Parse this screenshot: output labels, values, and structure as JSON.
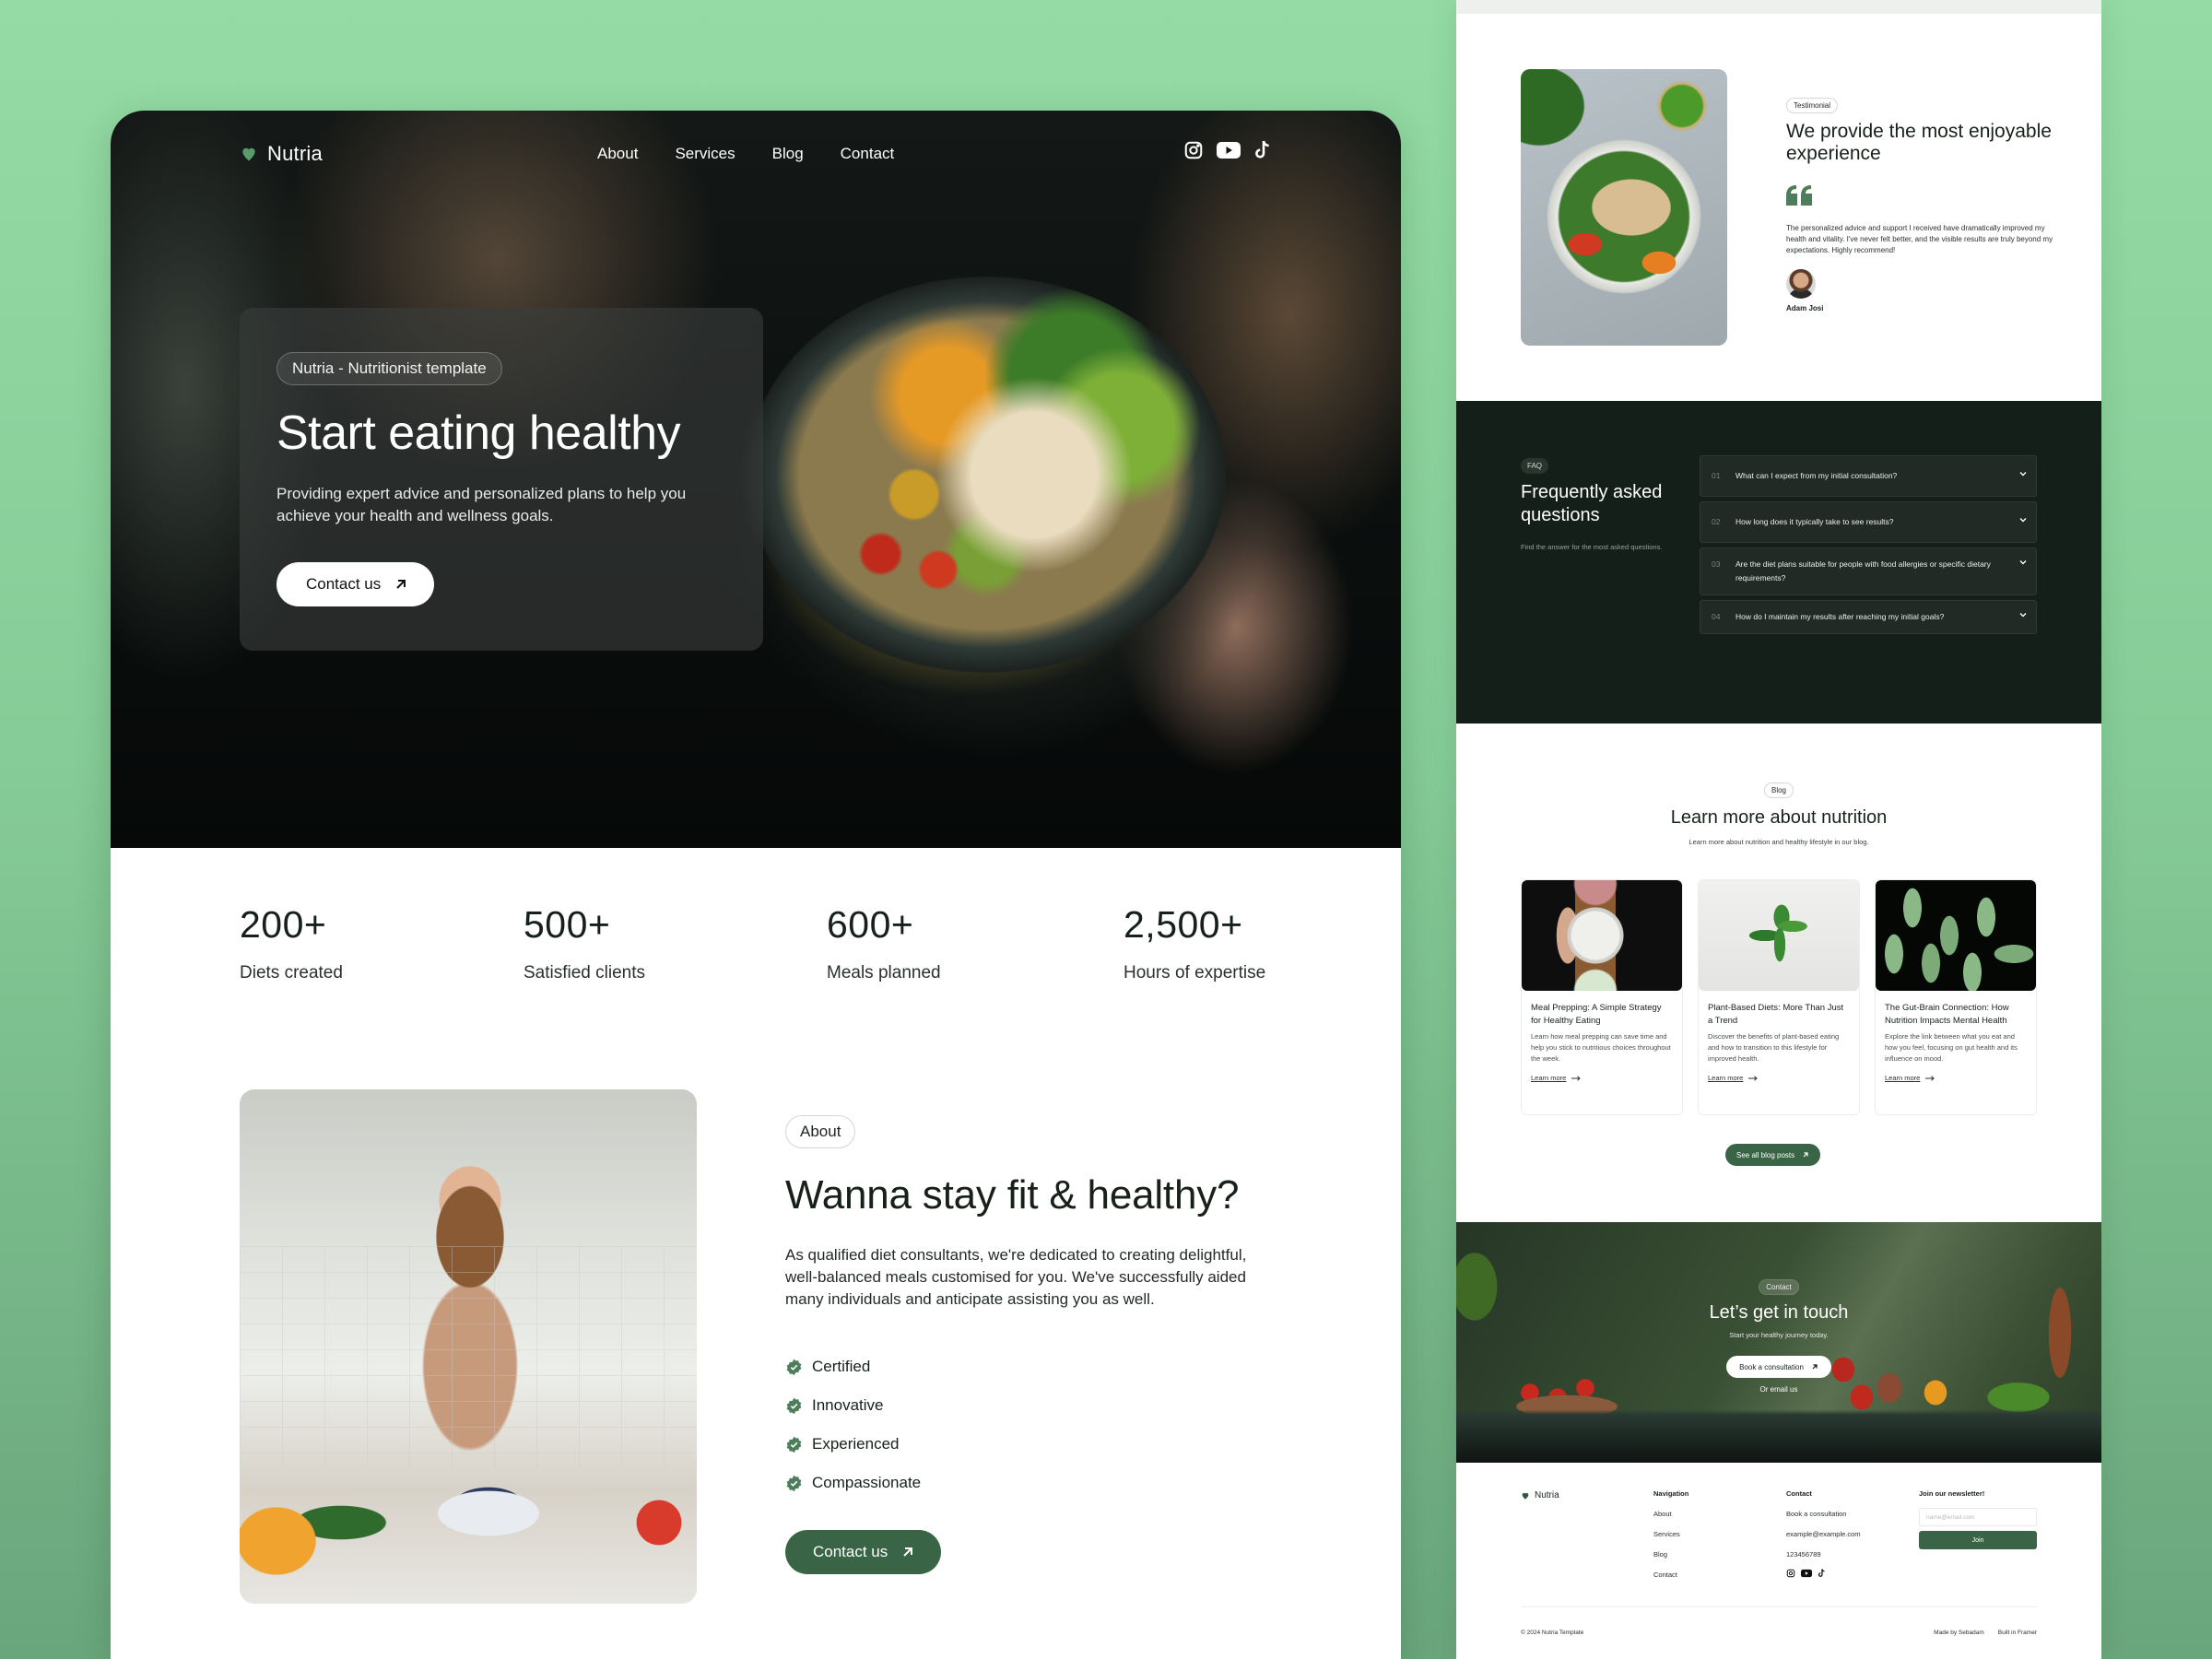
{
  "colors": {
    "brand_green": "#3a6446",
    "logo_green": "#5a9b6b",
    "faq_bg": "#131f18",
    "page_bg": "#95dba5"
  },
  "left": {
    "nav": {
      "logo": "Nutria",
      "links": [
        "About",
        "Services",
        "Blog",
        "Contact"
      ],
      "social": [
        "instagram-icon",
        "youtube-icon",
        "tiktok-icon"
      ]
    },
    "hero": {
      "badge": "Nutria - Nutritionist template",
      "title": "Start eating healthy",
      "subtitle": "Providing expert advice and personalized plans to help you achieve your health and wellness goals.",
      "cta": "Contact us"
    },
    "stats": [
      {
        "value": "200+",
        "label": "Diets created"
      },
      {
        "value": "500+",
        "label": "Satisfied clients"
      },
      {
        "value": "600+",
        "label": "Meals planned"
      },
      {
        "value": "2,500+",
        "label": "Hours of expertise"
      }
    ],
    "about": {
      "badge": "About",
      "title": "Wanna stay fit & healthy?",
      "text": "As qualified diet consultants, we're dedicated to creating delightful, well-balanced meals customised for you. We've successfully aided many individuals and anticipate assisting you as well.",
      "checks": [
        "Certified",
        "Innovative",
        "Experienced",
        "Compassionate"
      ],
      "cta": "Contact us"
    }
  },
  "right": {
    "testimonial": {
      "badge": "Testimonial",
      "title": "We provide the most enjoyable experience",
      "quote": "The personalized advice and support I received have dramatically improved my health and vitality. I've never felt better, and the visible results are truly beyond my expectations. Highly recommend!",
      "author": "Adam Josi"
    },
    "faq": {
      "badge": "FAQ",
      "title": "Frequently asked questions",
      "subtitle": "Find the answer for the most asked questions.",
      "items": [
        {
          "num": "01",
          "q": "What can I expect from my initial consultation?"
        },
        {
          "num": "02",
          "q": "How long does it typically take to see results?"
        },
        {
          "num": "03",
          "q": "Are the diet plans suitable for people with food allergies or specific dietary requirements?"
        },
        {
          "num": "04",
          "q": "How do I maintain my results after reaching my initial goals?"
        }
      ]
    },
    "blog": {
      "badge": "Blog",
      "title": "Learn more about nutrition",
      "subtitle": "Learn more about nutrition and healthy lifestyle in our blog.",
      "posts": [
        {
          "title": "Meal Prepping: A Simple Strategy for Healthy Eating",
          "text": "Learn how meal prepping can save time and help you stick to nutritious choices throughout the week.",
          "link": "Learn more"
        },
        {
          "title": "Plant-Based Diets: More Than Just a Trend",
          "text": "Discover the benefits of plant-based eating and how to transition to this lifestyle for improved health.",
          "link": "Learn more"
        },
        {
          "title": "The Gut-Brain Connection: How Nutrition Impacts Mental Health",
          "text": "Explore the link between what you eat and how you feel, focusing on gut health and its influence on mood.",
          "link": "Learn more"
        }
      ],
      "all_posts": "See all blog posts"
    },
    "contact": {
      "badge": "Contact",
      "title": "Let’s get in touch",
      "subtitle": "Start your healthy journey today.",
      "cta": "Book a consultation",
      "email": "Or email us"
    },
    "footer": {
      "logo": "Nutria",
      "nav_head": "Navigation",
      "nav_links": [
        "About",
        "Services",
        "Blog",
        "Contact"
      ],
      "contact_head": "Contact",
      "contact_links": [
        "Book a consultation",
        "example@example.com",
        "123456789"
      ],
      "newsletter_head": "Join our newsletter!",
      "newsletter_placeholder": "name@email.com",
      "join": "Join",
      "copyright": "© 2024 Nutria Template",
      "made_by": "Made by Sebadam",
      "built_in": "Built in Framer"
    }
  }
}
